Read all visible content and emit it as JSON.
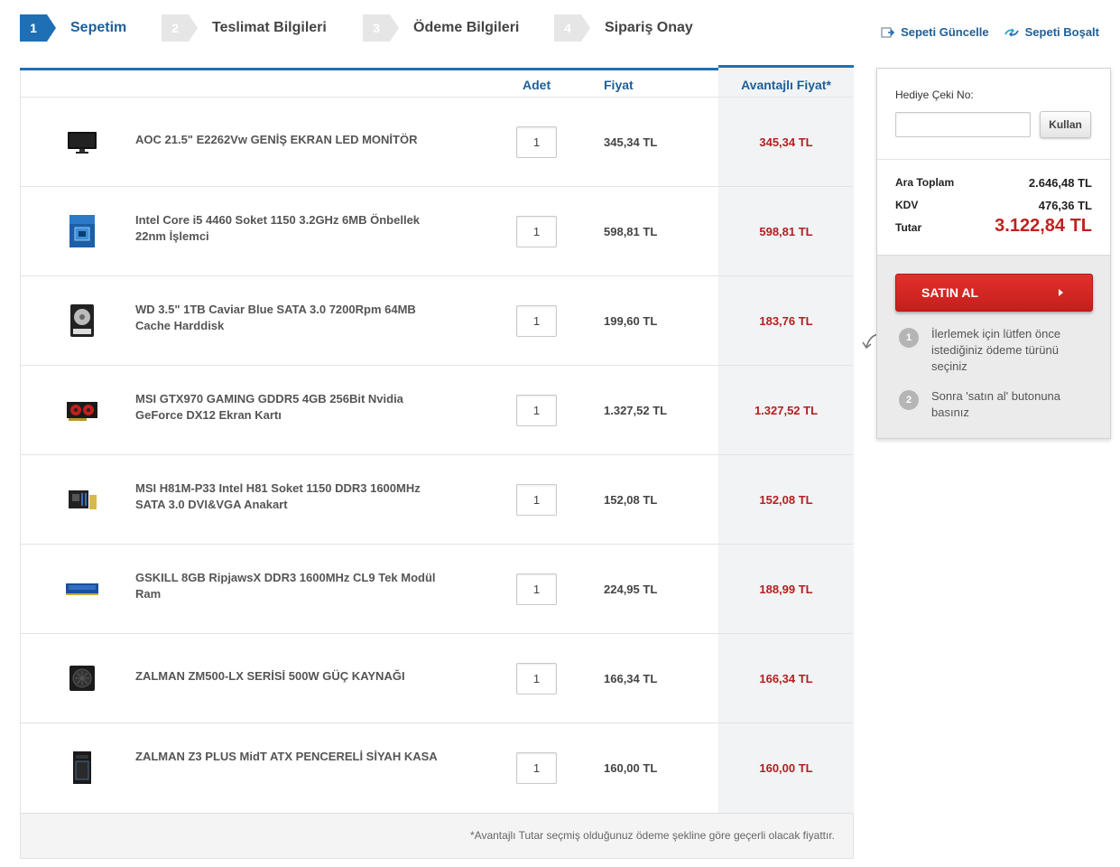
{
  "steps": [
    {
      "num": "1",
      "label": "Sepetim",
      "active": true
    },
    {
      "num": "2",
      "label": "Teslimat Bilgileri"
    },
    {
      "num": "3",
      "label": "Ödeme Bilgileri"
    },
    {
      "num": "4",
      "label": "Sipariş Onay"
    }
  ],
  "links": {
    "update": "Sepeti Güncelle",
    "empty": "Sepeti Boşalt"
  },
  "table": {
    "col_adet": "Adet",
    "col_fiyat": "Fiyat",
    "col_avantajli": "Avantajlı Fiyat*",
    "footer_note": "*Avantajlı Tutar seçmiş olduğunuz ödeme şekline göre geçerli olacak fiyattır."
  },
  "items": [
    {
      "name": "AOC 21.5\" E2262Vw GENİŞ EKRAN LED MONİTÖR",
      "qty": "1",
      "price": "345,34 TL",
      "adv_price": "345,34 TL",
      "icon": "monitor-icon"
    },
    {
      "name": "Intel Core i5 4460 Soket 1150 3.2GHz 6MB Önbellek 22nm İşlemci",
      "qty": "1",
      "price": "598,81 TL",
      "adv_price": "598,81 TL",
      "icon": "cpu-box-icon"
    },
    {
      "name": "WD 3.5\" 1TB Caviar Blue SATA 3.0 7200Rpm 64MB Cache Harddisk",
      "qty": "1",
      "price": "199,60 TL",
      "adv_price": "183,76 TL",
      "icon": "harddisk-icon"
    },
    {
      "name": "MSI GTX970 GAMING GDDR5 4GB 256Bit Nvidia GeForce DX12 Ekran Kartı",
      "qty": "1",
      "price": "1.327,52 TL",
      "adv_price": "1.327,52 TL",
      "icon": "graphics-card-icon"
    },
    {
      "name": "MSI H81M-P33 Intel H81 Soket 1150 DDR3 1600MHz SATA 3.0 DVI&VGA Anakart",
      "qty": "1",
      "price": "152,08 TL",
      "adv_price": "152,08 TL",
      "icon": "motherboard-icon"
    },
    {
      "name": "GSKILL 8GB RipjawsX DDR3 1600MHz CL9 Tek Modül Ram",
      "qty": "1",
      "price": "224,95 TL",
      "adv_price": "188,99 TL",
      "icon": "ram-icon"
    },
    {
      "name": "ZALMAN ZM500-LX SERİSİ 500W GÜÇ KAYNAĞI",
      "qty": "1",
      "price": "166,34 TL",
      "adv_price": "166,34 TL",
      "icon": "power-supply-icon"
    },
    {
      "name": "ZALMAN Z3 PLUS MidT ATX PENCERELİ SİYAH KASA",
      "qty": "1",
      "price": "160,00 TL",
      "adv_price": "160,00 TL",
      "icon": "pc-case-icon"
    }
  ],
  "side": {
    "gift_label": "Hediye Çeki No:",
    "gift_value": "",
    "gift_button": "Kullan",
    "subtotal_label": "Ara Toplam",
    "subtotal_value": "2.646,48 TL",
    "tax_label": "KDV",
    "tax_value": "476,36 TL",
    "total_label": "Tutar",
    "total_value": "3.122,84 TL",
    "buy_button": "SATIN AL",
    "hint1_num": "1",
    "hint1": "İlerlemek için lütfen önce istediğiniz ödeme türünü seçiniz",
    "hint2_num": "2",
    "hint2": "Sonra 'satın al' butonuna basınız"
  },
  "colors": {
    "accent": "#1f6fb5",
    "price_red": "#b3201e",
    "buy_red": "#d42825"
  }
}
